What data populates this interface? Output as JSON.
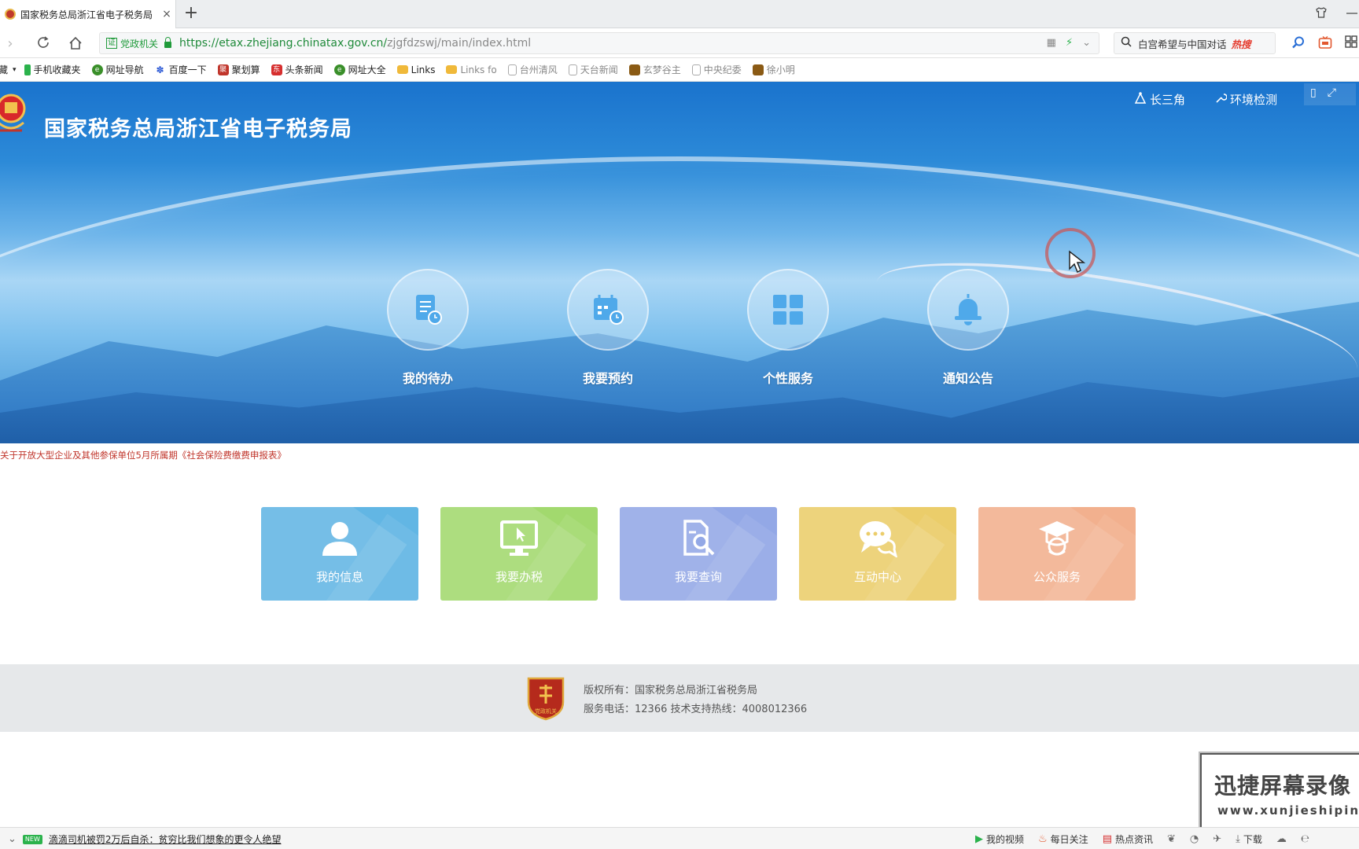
{
  "browser": {
    "tab_title": "国家税务总局浙江省电子税务局",
    "tab_close": "×",
    "new_tab": "+",
    "address": {
      "gov_badge": "党政机关",
      "gov_badge_char": "证",
      "url_host": "https://etax.zhejiang.chinatax.gov.cn/",
      "url_path": "zjgfdzswj/main/index.html"
    },
    "search": {
      "text": "白宫希望与中国对话",
      "hot_label": "热搜"
    },
    "bookmarks": [
      {
        "label": "收藏",
        "color": "#ffffff"
      },
      {
        "label": "手机收藏夹",
        "color": "#2bb24c"
      },
      {
        "label": "网址导航",
        "color": "#3a8f2a"
      },
      {
        "label": "百度一下",
        "color": "#2e5bd6"
      },
      {
        "label": "聚划算",
        "color": "#c0352b"
      },
      {
        "label": "头条新闻",
        "color": "#d62f2f"
      },
      {
        "label": "网址大全",
        "color": "#3a8f2a"
      },
      {
        "label": "Links",
        "color": "#f0b93a"
      },
      {
        "label": "Links fo",
        "color": "#f0b93a"
      },
      {
        "label": "台州清风",
        "color": "#bbbbbb"
      },
      {
        "label": "天台新闻",
        "color": "#bbbbbb"
      },
      {
        "label": "玄梦谷主",
        "color": "#8a5a14"
      },
      {
        "label": "中央纪委",
        "color": "#bbbbbb"
      },
      {
        "label": "徐小明",
        "color": "#8a5a14"
      }
    ]
  },
  "header": {
    "site_title": "国家税务总局浙江省电子税务局",
    "region_label": "长三角",
    "env_check_label": "环境检测"
  },
  "banner_services": [
    {
      "label": "我的待办",
      "icon": "todo-document-icon"
    },
    {
      "label": "我要预约",
      "icon": "calendar-clock-icon"
    },
    {
      "label": "个性服务",
      "icon": "grid-apps-icon"
    },
    {
      "label": "通知公告",
      "icon": "bell-icon"
    }
  ],
  "notice_text": "关于开放大型企业及其他参保单位5月所属期《社会保险费缴费申报表》",
  "cards": [
    {
      "label": "我的信息",
      "icon": "user-icon",
      "color": "#62b6e4"
    },
    {
      "label": "我要办税",
      "icon": "monitor-cursor-icon",
      "color": "#a2d96e"
    },
    {
      "label": "我要查询",
      "icon": "document-search-icon",
      "color": "#93a8e6"
    },
    {
      "label": "互动中心",
      "icon": "chat-bubbles-icon",
      "color": "#ebcd6a"
    },
    {
      "label": "公众服务",
      "icon": "graduate-icon",
      "color": "#f2b08e"
    }
  ],
  "footer": {
    "copyright": "版权所有：国家税务总局浙江省税务局",
    "contact": "服务电话：12366 技术支持热线：4008012366",
    "logo_text": "党政机关"
  },
  "watermark": {
    "line1": "迅捷屏幕录像",
    "line2": "www.xunjieshipin"
  },
  "statusbar": {
    "new_tag": "NEW",
    "news": "滴滴司机被罚2万后自杀：贫穷比我们想象的更令人绝望",
    "my_videos": "我的视频",
    "daily_focus": "每日关注",
    "hot_news": "热点资讯",
    "download": "下载"
  }
}
